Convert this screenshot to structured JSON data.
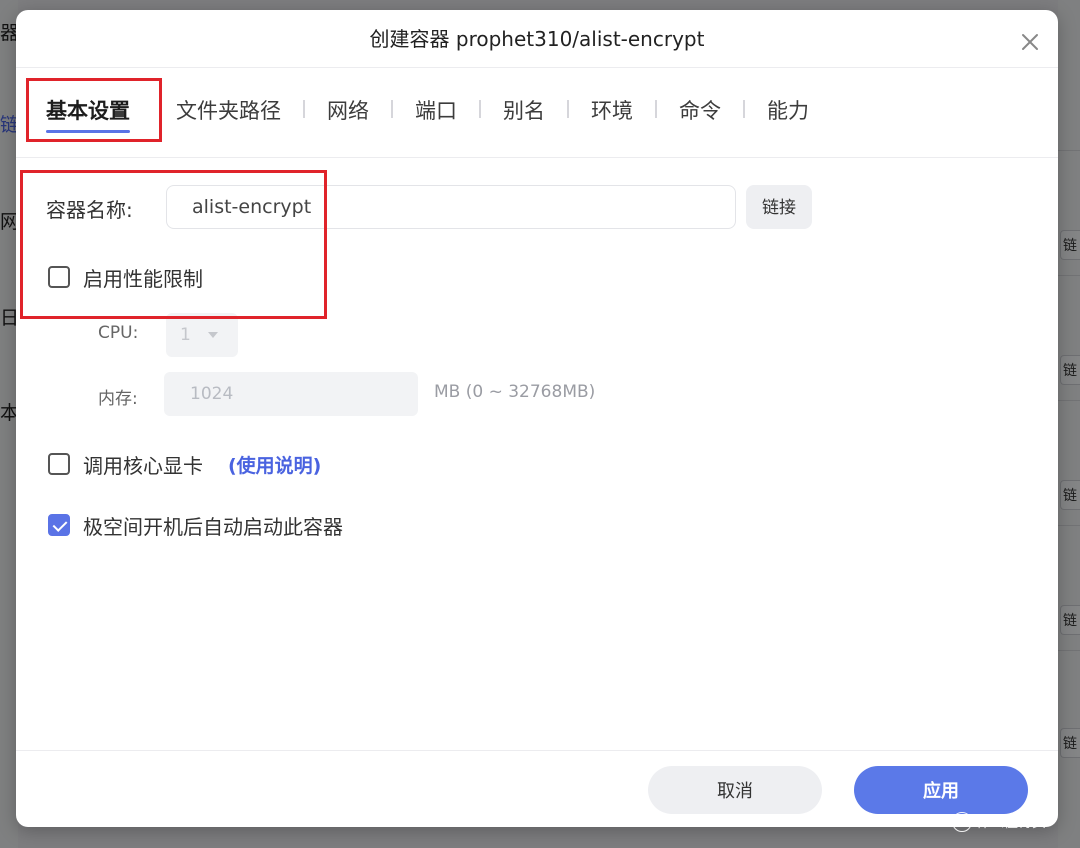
{
  "background": {
    "left_fragments": [
      "器",
      "链",
      "网",
      "日",
      "本"
    ],
    "right_chip_label": "链"
  },
  "dialog": {
    "title": "创建容器 prophet310/alist-encrypt",
    "close_icon": "close-icon"
  },
  "tabs": [
    {
      "label": "基本设置",
      "active": true
    },
    {
      "label": "文件夹路径",
      "active": false
    },
    {
      "label": "网络",
      "active": false
    },
    {
      "label": "端口",
      "active": false
    },
    {
      "label": "别名",
      "active": false
    },
    {
      "label": "环境",
      "active": false
    },
    {
      "label": "命令",
      "active": false
    },
    {
      "label": "能力",
      "active": false
    }
  ],
  "form": {
    "container_name_label": "容器名称:",
    "container_name_value": "alist-encrypt",
    "link_button": "链接",
    "perf_limit": {
      "label": "启用性能限制",
      "checked": false
    },
    "cpu": {
      "label": "CPU:",
      "value": "1"
    },
    "memory": {
      "label": "内存:",
      "value": "1024",
      "hint": "MB (0 ~ 32768MB)"
    },
    "gpu": {
      "label": "调用核心显卡",
      "help_link": "(使用说明)",
      "checked": false
    },
    "autostart": {
      "label": "极空间开机后自动启动此容器",
      "checked": true
    }
  },
  "footer": {
    "cancel": "取消",
    "apply": "应用"
  },
  "watermark": {
    "badge": "值",
    "text": "什么值得买"
  },
  "colors": {
    "accent": "#5a73e6",
    "apply_button": "#5b79e8",
    "highlight": "#e0232a"
  }
}
